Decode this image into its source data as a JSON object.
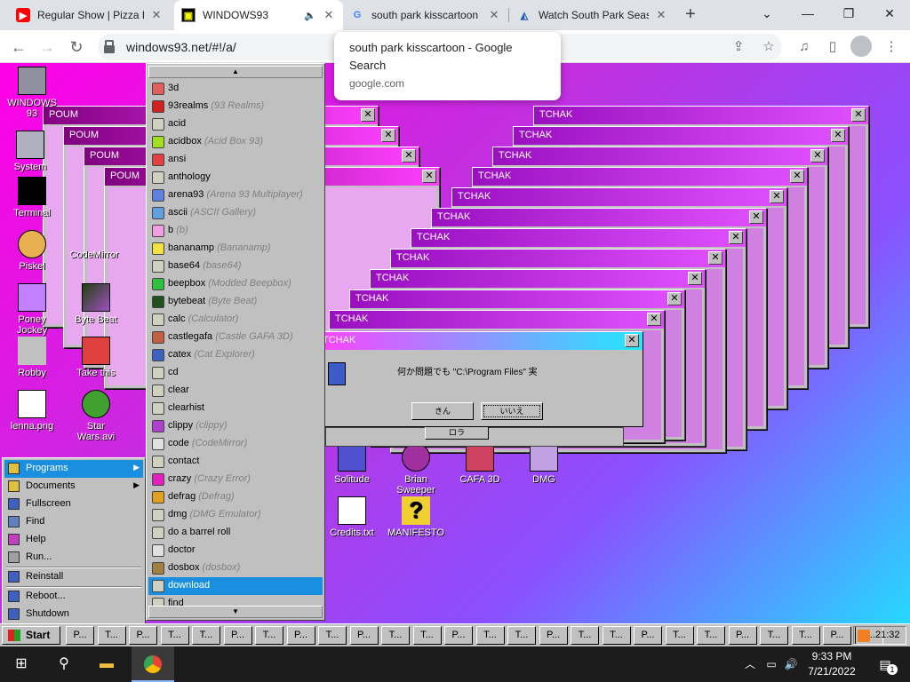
{
  "browser": {
    "tabs": [
      {
        "title": "Regular Show | Pizza Pu",
        "favicon": "youtube-icon"
      },
      {
        "title": "WINDOWS93",
        "favicon": "windows93-icon",
        "active": true
      },
      {
        "title": "south park kisscartoon",
        "favicon": "google-icon"
      },
      {
        "title": "Watch South Park Seas",
        "favicon": "kisscartoon-icon"
      }
    ],
    "url": "windows93.net/#!/a/",
    "tooltip": {
      "title": "south park kisscartoon - Google Search",
      "domain": "google.com"
    },
    "accent": "#1a73e8"
  },
  "desktop": {
    "icons": [
      {
        "label": "WINDOWS 93",
        "color": "#9090a0"
      },
      {
        "label": "System",
        "color": "#b0b0c0"
      },
      {
        "label": "Terminal",
        "color": "#000000"
      },
      {
        "label": "Piskel",
        "color": "#e8b050"
      },
      {
        "label": "CodeMirror",
        "color": "#ff80c0"
      },
      {
        "label": "Poney Jockey",
        "color": "#c080ff"
      },
      {
        "label": "Byte Beat",
        "color": "#408020"
      },
      {
        "label": "Robby",
        "color": "#c0c0c0"
      },
      {
        "label": "Take this",
        "color": "#e04040"
      },
      {
        "label": "lenna.png",
        "color": "#e03030"
      },
      {
        "label": "Star Wars.avi",
        "color": "#40a030"
      },
      {
        "label": "Solitude",
        "color": "#5050d0"
      },
      {
        "label": "Brian Sweeper",
        "color": "#a030a0"
      },
      {
        "label": "CAFA 3D",
        "color": "#d04060"
      },
      {
        "label": "DMG",
        "color": "#c0a0e0"
      },
      {
        "label": "Credits.txt",
        "color": "#ffffff"
      },
      {
        "label": "MANIFESTO",
        "color": "#f0d030"
      }
    ],
    "poum_windows": [
      "POUM",
      "POUM",
      "POUM",
      "POUM"
    ],
    "tchak_windows": [
      "TCHAK",
      "TCHAK",
      "TCHAK",
      "TCHAK",
      "TCHAK",
      "TCHAK",
      "TCHAK",
      "TCHAK",
      "TCHAK",
      "TCHAK",
      "TCHAK",
      "TCHAK"
    ],
    "dialog": {
      "title": "TCHAK",
      "message": "何か問題でも \"C:\\Program Files\" 実",
      "buttons": [
        "きん",
        "いいえ"
      ],
      "sub_button": "ロラ"
    }
  },
  "start_menu": {
    "items": [
      {
        "label": "Programs",
        "has_submenu": true,
        "selected": true
      },
      {
        "label": "Documents",
        "has_submenu": true
      },
      {
        "label": "Fullscreen"
      },
      {
        "label": "Find"
      },
      {
        "label": "Help"
      },
      {
        "label": "Run..."
      },
      {
        "label": "Reinstall"
      },
      {
        "label": "Reboot..."
      },
      {
        "label": "Shutdown"
      }
    ]
  },
  "programs": [
    {
      "name": "3d",
      "alt": "",
      "color": "#e06060"
    },
    {
      "name": "93realms",
      "alt": "(93 Realms)",
      "color": "#d02020"
    },
    {
      "name": "acid",
      "alt": "",
      "color": "#d0d0c0"
    },
    {
      "name": "acidbox",
      "alt": "(Acid Box 93)",
      "color": "#a0e020"
    },
    {
      "name": "ansi",
      "alt": "",
      "color": "#e04040"
    },
    {
      "name": "anthology",
      "alt": "",
      "color": "#d0d0c0"
    },
    {
      "name": "arena93",
      "alt": "(Arena 93 Multiplayer)",
      "color": "#6080e0"
    },
    {
      "name": "ascii",
      "alt": "(ASCII Gallery)",
      "color": "#60a0e0"
    },
    {
      "name": "b",
      "alt": "(b)",
      "color": "#f0a0e0"
    },
    {
      "name": "bananamp",
      "alt": "(Bananamp)",
      "color": "#f0e040"
    },
    {
      "name": "base64",
      "alt": "(base64)",
      "color": "#d0d0c0"
    },
    {
      "name": "beepbox",
      "alt": "(Modded Beepbox)",
      "color": "#30c040"
    },
    {
      "name": "bytebeat",
      "alt": "(Byte Beat)",
      "color": "#205020"
    },
    {
      "name": "calc",
      "alt": "(Calculator)",
      "color": "#d0d0c0"
    },
    {
      "name": "castlegafa",
      "alt": "(Castle GAFA 3D)",
      "color": "#c06040"
    },
    {
      "name": "catex",
      "alt": "(Cat Explorer)",
      "color": "#4060c0"
    },
    {
      "name": "cd",
      "alt": "",
      "color": "#d0d0c0"
    },
    {
      "name": "clear",
      "alt": "",
      "color": "#d0d0c0"
    },
    {
      "name": "clearhist",
      "alt": "",
      "color": "#d0d0c0"
    },
    {
      "name": "clippy",
      "alt": "(clippy)",
      "color": "#b040d0"
    },
    {
      "name": "code",
      "alt": "(CodeMirror)",
      "color": "#e0e0e0"
    },
    {
      "name": "contact",
      "alt": "",
      "color": "#d0d0c0"
    },
    {
      "name": "crazy",
      "alt": "(Crazy Error)",
      "color": "#e020c0"
    },
    {
      "name": "defrag",
      "alt": "(Defrag)",
      "color": "#e0a020"
    },
    {
      "name": "dmg",
      "alt": "(DMG Emulator)",
      "color": "#d0d0c0"
    },
    {
      "name": "do a barrel roll",
      "alt": "",
      "color": "#d0d0c0"
    },
    {
      "name": "doctor",
      "alt": "",
      "color": "#e0e0e0"
    },
    {
      "name": "dosbox",
      "alt": "(dosbox)",
      "color": "#a08040"
    },
    {
      "name": "download",
      "alt": "(download)",
      "color": "#d0d0c0",
      "selected": true
    },
    {
      "name": "find",
      "alt": "",
      "color": "#d0d0c0"
    }
  ],
  "taskbar93": {
    "start_label": "Start",
    "buttons": [
      "P...",
      "T...",
      "P...",
      "T...",
      "T...",
      "P...",
      "T...",
      "P...",
      "T...",
      "P...",
      "T...",
      "T...",
      "P...",
      "T...",
      "T...",
      "P...",
      "T...",
      "T...",
      "P...",
      "T...",
      "T...",
      "P...",
      "T...",
      "T...",
      "P...",
      "T..."
    ],
    "clock": "21:32"
  },
  "windows_taskbar": {
    "time": "9:33 PM",
    "date": "7/21/2022",
    "notification_count": "1"
  }
}
